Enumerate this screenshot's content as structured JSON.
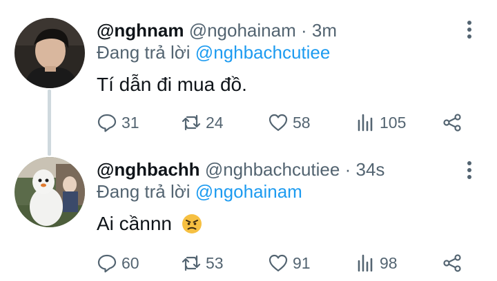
{
  "tweets": [
    {
      "display_name": "@nghnam",
      "handle": "@ngohainam",
      "separator": "·",
      "time": "3m",
      "reply_prefix": "Đang trả lời",
      "reply_to": "@nghbachcutiee",
      "text": "Tí dẫn đi mua đồ.",
      "emoji": "",
      "stats": {
        "replies": "31",
        "retweets": "24",
        "likes": "58",
        "views": "105"
      },
      "icons": [
        "reply-icon",
        "retweet-icon",
        "like-icon",
        "views-icon",
        "share-icon",
        "more-icon"
      ]
    },
    {
      "display_name": "@nghbachh",
      "handle": "@nghbachcutiee",
      "separator": "·",
      "time": "34s",
      "reply_prefix": "Đang trả lời",
      "reply_to": "@ngohainam",
      "text": "Ai cầnnn",
      "emoji": "angry-face-emoji",
      "stats": {
        "replies": "60",
        "retweets": "53",
        "likes": "91",
        "views": "98"
      },
      "icons": [
        "reply-icon",
        "retweet-icon",
        "like-icon",
        "views-icon",
        "share-icon",
        "more-icon"
      ]
    }
  ],
  "colors": {
    "text": "#0f1419",
    "secondary": "#536471",
    "link": "#1d9bf0",
    "thread_line": "#cfd9de",
    "background": "#ffffff"
  }
}
